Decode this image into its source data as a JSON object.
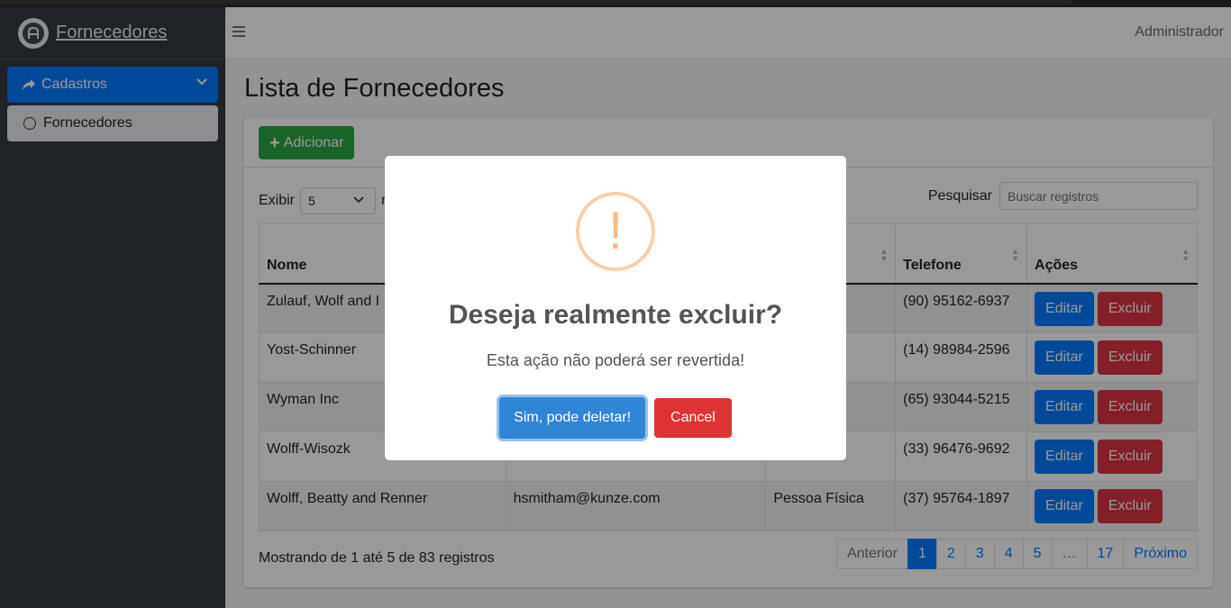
{
  "brand": {
    "name": "Fornecedores",
    "logo_icon": "logo-icon"
  },
  "sidebar": {
    "items": [
      {
        "label": "Cadastros",
        "icon": "share-icon",
        "active": true
      },
      {
        "label": "Fornecedores",
        "icon": "circle-icon"
      }
    ]
  },
  "header": {
    "user": "Administrador"
  },
  "page": {
    "title": "Lista de Fornecedores"
  },
  "toolbar": {
    "add_label": "Adicionar"
  },
  "table_controls": {
    "show_label": "Exibir",
    "page_size": "5",
    "page_size_suffix": "r",
    "search_label": "Pesquisar",
    "search_placeholder": "Buscar registros"
  },
  "table": {
    "columns": [
      "Nome",
      "",
      "",
      "Telefone",
      "Ações"
    ],
    "rows": [
      {
        "nome": "Zulauf, Wolf and I",
        "email": "",
        "tipo": "ídica",
        "telefone": "(90) 95162-6937"
      },
      {
        "nome": "Yost-Schinner",
        "email": "",
        "tipo": "ídica",
        "telefone": "(14) 98984-2596"
      },
      {
        "nome": "Wyman Inc",
        "email": "",
        "tipo": "ídica",
        "telefone": "(65) 93044-5215"
      },
      {
        "nome": "Wolff-Wisozk",
        "email": "",
        "tipo": "ídica",
        "telefone": "(33) 96476-9692"
      },
      {
        "nome": "Wolff, Beatty and Renner",
        "email": "hsmitham@kunze.com",
        "tipo": "Pessoa Física",
        "telefone": "(37) 95764-1897"
      }
    ],
    "edit_label": "Editar",
    "delete_label": "Excluir"
  },
  "footer": {
    "info": "Mostrando de 1 até 5 de 83 registros",
    "pagination": {
      "previous": "Anterior",
      "pages": [
        "1",
        "2",
        "3",
        "4",
        "5",
        "…",
        "17"
      ],
      "current": "1",
      "next": "Próximo"
    }
  },
  "modal": {
    "icon": "!",
    "title": "Deseja realmente excluir?",
    "text": "Esta ação não poderá ser revertida!",
    "confirm_label": "Sim, pode deletar!",
    "cancel_label": "Cancel"
  },
  "colors": {
    "primary": "#007bff",
    "success": "#28a745",
    "danger": "#dc3545",
    "sidebar_bg": "#343a40",
    "modal_confirm": "#3085d6",
    "modal_cancel": "#dd3333",
    "warning_ring": "#facea8"
  }
}
